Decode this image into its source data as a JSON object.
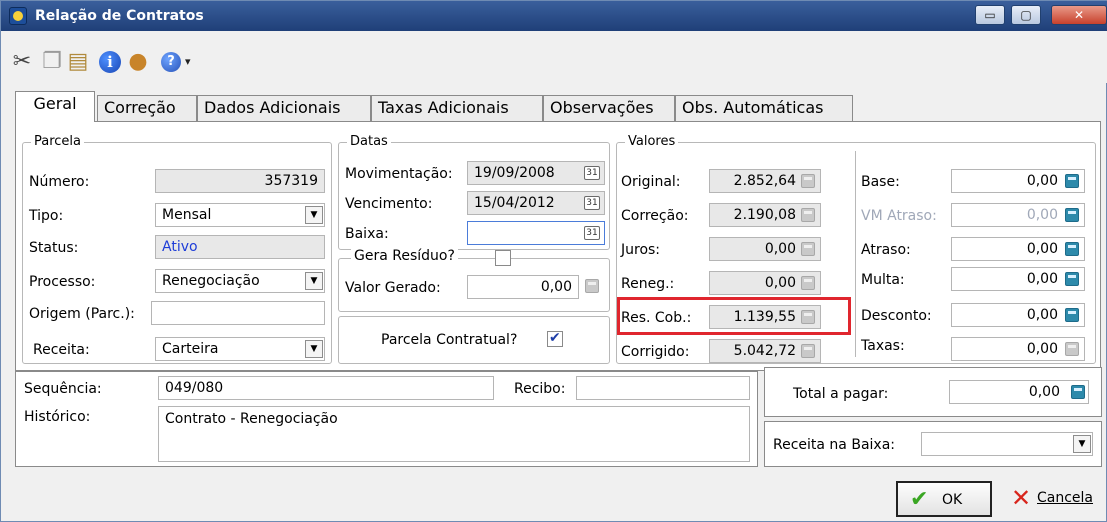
{
  "window": {
    "title": "Relação de Contratos",
    "controls": {
      "minimize": "▭",
      "maximize": "▢",
      "close": "✕"
    }
  },
  "toolbar": {
    "icons": [
      "cut-icon",
      "copy-icon",
      "paste-icon",
      "info-icon",
      "user-icon",
      "help-icon"
    ],
    "info_glyph": "i",
    "help_glyph": "?",
    "dropdown_glyph": "▾"
  },
  "tabs": [
    {
      "label": "Geral",
      "active": true
    },
    {
      "label": "Correção"
    },
    {
      "label": "Dados Adicionais"
    },
    {
      "label": "Taxas Adicionais"
    },
    {
      "label": "Observações"
    },
    {
      "label": "Obs. Automáticas"
    }
  ],
  "parcela": {
    "title": "Parcela",
    "numero_label": "Número:",
    "numero": "357319",
    "tipo_label": "Tipo:",
    "tipo": "Mensal",
    "status_label": "Status:",
    "status": "Ativo",
    "processo_label": "Processo:",
    "processo": "Renegociação",
    "origem_label": "Origem (Parc.):",
    "origem": "",
    "receita_label": "Receita:",
    "receita": "Carteira"
  },
  "datas": {
    "title": "Datas",
    "movimentacao_label": "Movimentação:",
    "movimentacao": "19/09/2008",
    "vencimento_label": "Vencimento:",
    "vencimento": "15/04/2012",
    "baixa_label": "Baixa:",
    "baixa": "",
    "calendar_glyph": "31",
    "gera_residuo_label": "Gera Resíduo?",
    "gera_residuo_checked": false,
    "valor_gerado_label": "Valor Gerado:",
    "valor_gerado": "0,00",
    "parcela_contratual_label": "Parcela Contratual?",
    "parcela_contratual_checked": true
  },
  "valores": {
    "title": "Valores",
    "original_label": "Original:",
    "original": "2.852,64",
    "correcao_label": "Correção:",
    "correcao": "2.190,08",
    "juros_label": "Juros:",
    "juros": "0,00",
    "reneg_label": "Reneg.:",
    "reneg": "0,00",
    "res_cob_label": "Res. Cob.:",
    "res_cob": "1.139,55",
    "corrigido_label": "Corrigido:",
    "corrigido": "5.042,72"
  },
  "adicionais": {
    "base_label": "Base:",
    "base": "0,00",
    "vm_atraso_label": "VM Atraso:",
    "vm_atraso": "0,00",
    "atraso_label": "Atraso:",
    "atraso": "0,00",
    "multa_label": "Multa:",
    "multa": "0,00",
    "desconto_label": "Desconto:",
    "desconto": "0,00",
    "taxas_label": "Taxas:",
    "taxas": "0,00"
  },
  "info": {
    "sequencia_label": "Sequência:",
    "sequencia": "049/080",
    "recibo_label": "Recibo:",
    "recibo": "",
    "historico_label": "Histórico:",
    "historico": "Contrato - Renegociação"
  },
  "totais": {
    "total_label": "Total a pagar:",
    "total": "0,00",
    "receita_baixa_label": "Receita na Baixa:",
    "receita_baixa": ""
  },
  "buttons": {
    "ok": "OK",
    "cancel": "Cancela",
    "ok_glyph": "✔",
    "cancel_glyph": "✕"
  },
  "colors": {
    "titlebar": "#2b4f8c",
    "highlight": "#e0262e",
    "status_text": "#1e3dd8",
    "accent_icon": "#2d8aab"
  }
}
